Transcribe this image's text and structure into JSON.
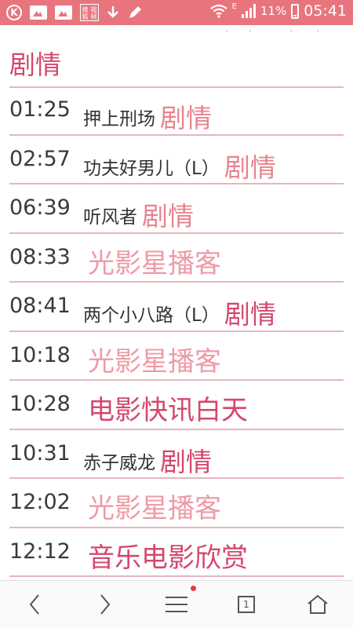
{
  "status_bar": {
    "sohu_label_top": "搜狐",
    "sohu_label_bottom": "视频",
    "network": "E",
    "battery": "11%",
    "time": "05:41"
  },
  "section": {
    "title": "剧情"
  },
  "schedule": [
    {
      "time": "01:25",
      "program": "押上刑场",
      "tag": "剧情"
    },
    {
      "time": "02:57",
      "program": "功夫好男儿（L）",
      "tag": "剧情"
    },
    {
      "time": "06:39",
      "program": "听风者",
      "tag": "剧情"
    },
    {
      "time": "08:33",
      "program": "光影星播客",
      "tag": ""
    },
    {
      "time": "08:41",
      "program": "两个小八路（L）",
      "tag": "剧情"
    },
    {
      "time": "10:18",
      "program": "光影星播客",
      "tag": ""
    },
    {
      "time": "10:28",
      "program": "电影快讯白天",
      "tag": ""
    },
    {
      "time": "10:31",
      "program": "赤子威龙",
      "tag": "剧情"
    },
    {
      "time": "12:02",
      "program": "光影星播客",
      "tag": ""
    },
    {
      "time": "12:12",
      "program": "音乐电影欣赏",
      "tag": ""
    }
  ],
  "bottom_nav": {
    "tab_count": "1",
    "icons": [
      "back-icon",
      "forward-icon",
      "menu-icon",
      "tabs-icon",
      "home-icon"
    ]
  },
  "colors": {
    "status_bar": "#e8757e",
    "accent": "#d4476d",
    "light_accent": "#ef9aa5",
    "divider": "#e7b5be"
  }
}
